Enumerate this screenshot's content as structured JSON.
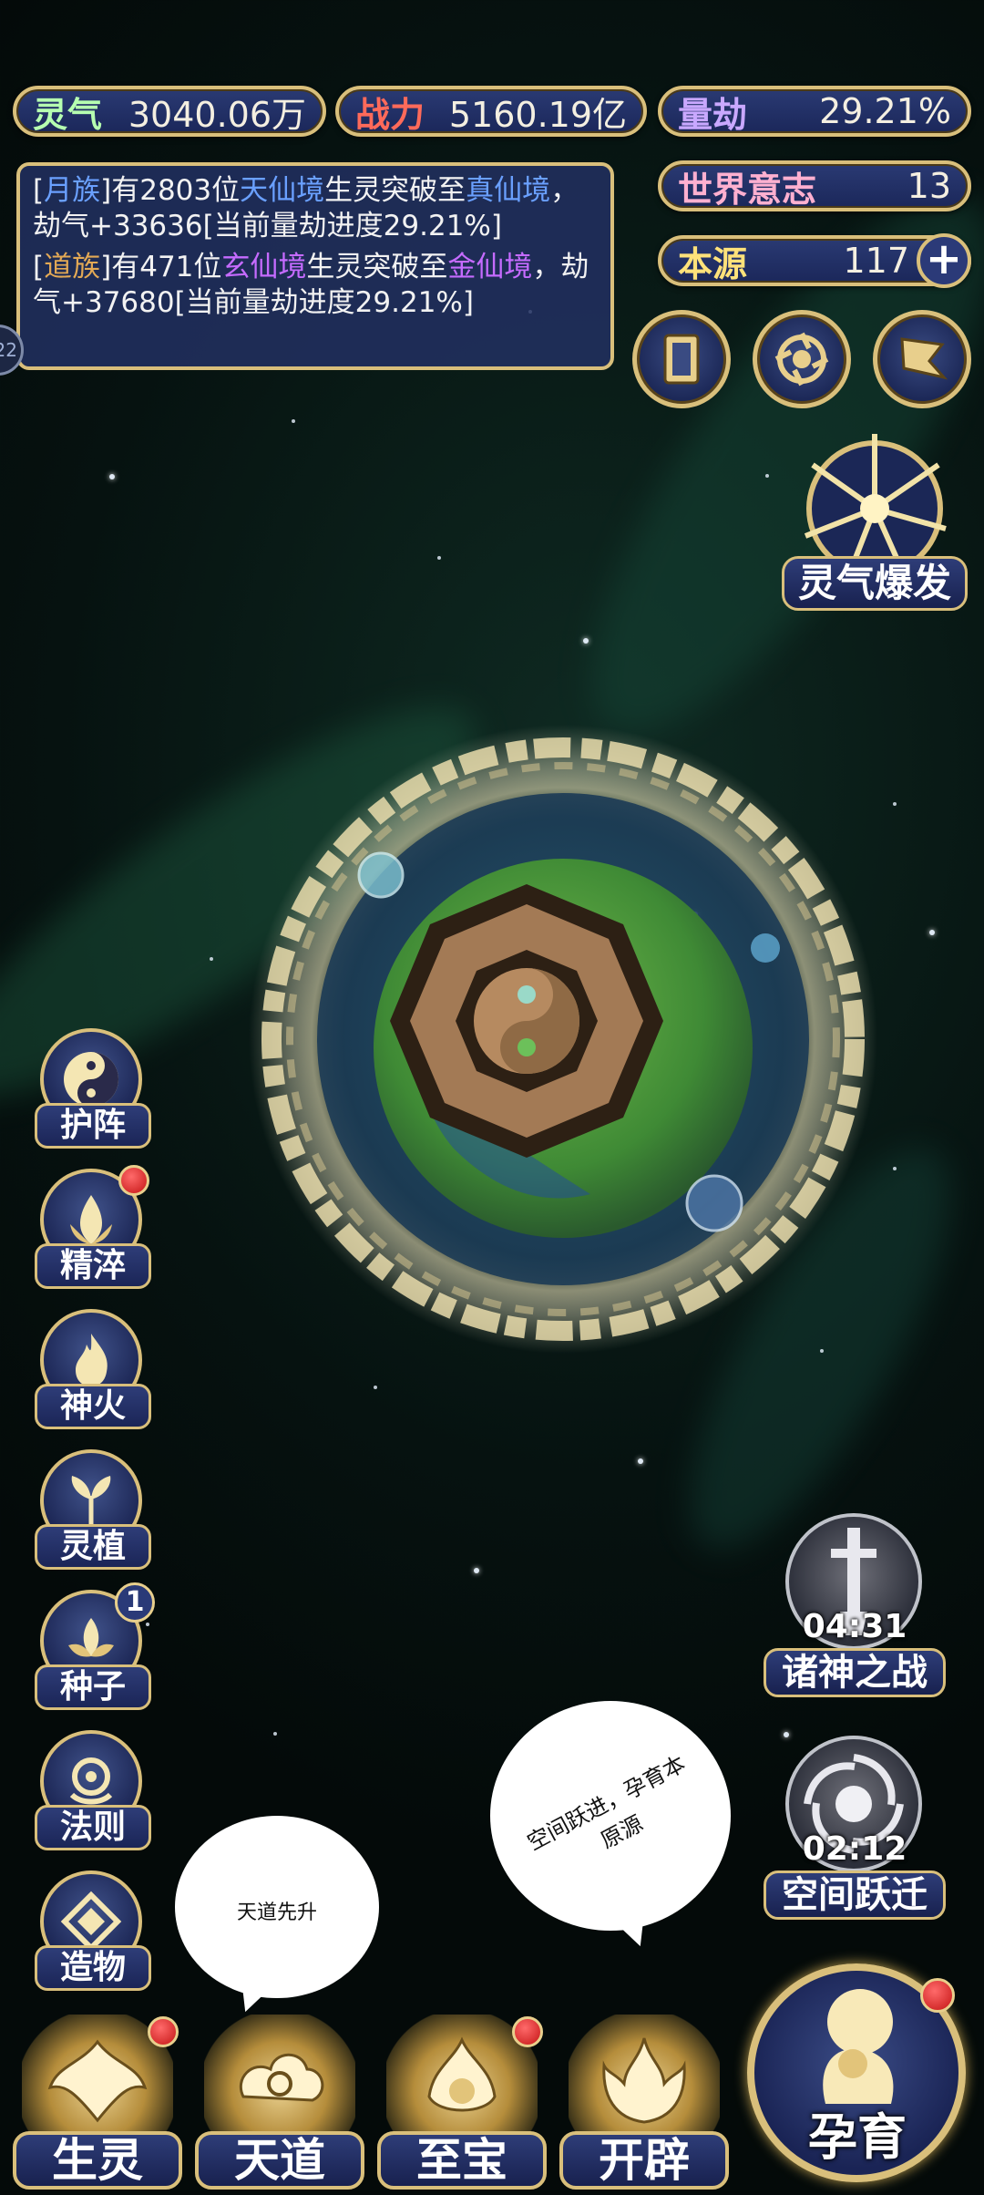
{
  "top_stats": {
    "lingqi": {
      "label": "灵气",
      "value": "3040.06万"
    },
    "zhanli": {
      "label": "战力",
      "value": "5160.19亿"
    },
    "liangjie": {
      "label": "量劫",
      "value": "29.21%"
    },
    "shijie_yizhi": {
      "label": "世界意志",
      "value": "13"
    },
    "benyuan": {
      "label": "本源",
      "value": "117"
    }
  },
  "log": {
    "entry1": {
      "race_prefix": "[",
      "race": "月族",
      "race_suffix": "]",
      "t1": "有2803位",
      "realm_from": "天仙境",
      "t2": "生灵突破至",
      "realm_to": "真仙境",
      "t3": "，劫气+33636[当前量劫进度29.21%]"
    },
    "entry2": {
      "race_prefix": "[",
      "race": "道族",
      "race_suffix": "]",
      "t1": "有471位",
      "realm_from": "玄仙境",
      "t2": "生灵突破至",
      "realm_to": "金仙境",
      "t3": "，劫气+37680[当前量劫进度29.21%]"
    }
  },
  "edge_tab": "22",
  "burst": {
    "label": "灵气爆发"
  },
  "side_menu": [
    {
      "label": "护阵",
      "icon": "taiji-icon"
    },
    {
      "label": "精淬",
      "icon": "lotus-flame-icon",
      "reddot": true
    },
    {
      "label": "神火",
      "icon": "fire-icon"
    },
    {
      "label": "灵植",
      "icon": "plant-icon"
    },
    {
      "label": "种子",
      "icon": "seed-icon",
      "badge": "1"
    },
    {
      "label": "法则",
      "icon": "law-icon"
    },
    {
      "label": "造物",
      "icon": "creation-icon"
    }
  ],
  "timers": {
    "zhushen": {
      "label": "诸神之战",
      "time": "04:31"
    },
    "kongjian": {
      "label": "空间跃迁",
      "time": "02:12"
    }
  },
  "bubbles": {
    "left": "天道先升",
    "right_line1": "空间跃进，孕育本",
    "right_line2": "原源"
  },
  "bottom_menu": [
    {
      "label": "生灵",
      "reddot": true
    },
    {
      "label": "天道"
    },
    {
      "label": "至宝",
      "reddot": true
    },
    {
      "label": "开辟"
    }
  ],
  "yunyu": {
    "label": "孕育",
    "reddot": true
  },
  "colors": {
    "gold_border": "#d9bf7b",
    "panel_blue": "#22306a",
    "accent_red": "#c41414"
  }
}
